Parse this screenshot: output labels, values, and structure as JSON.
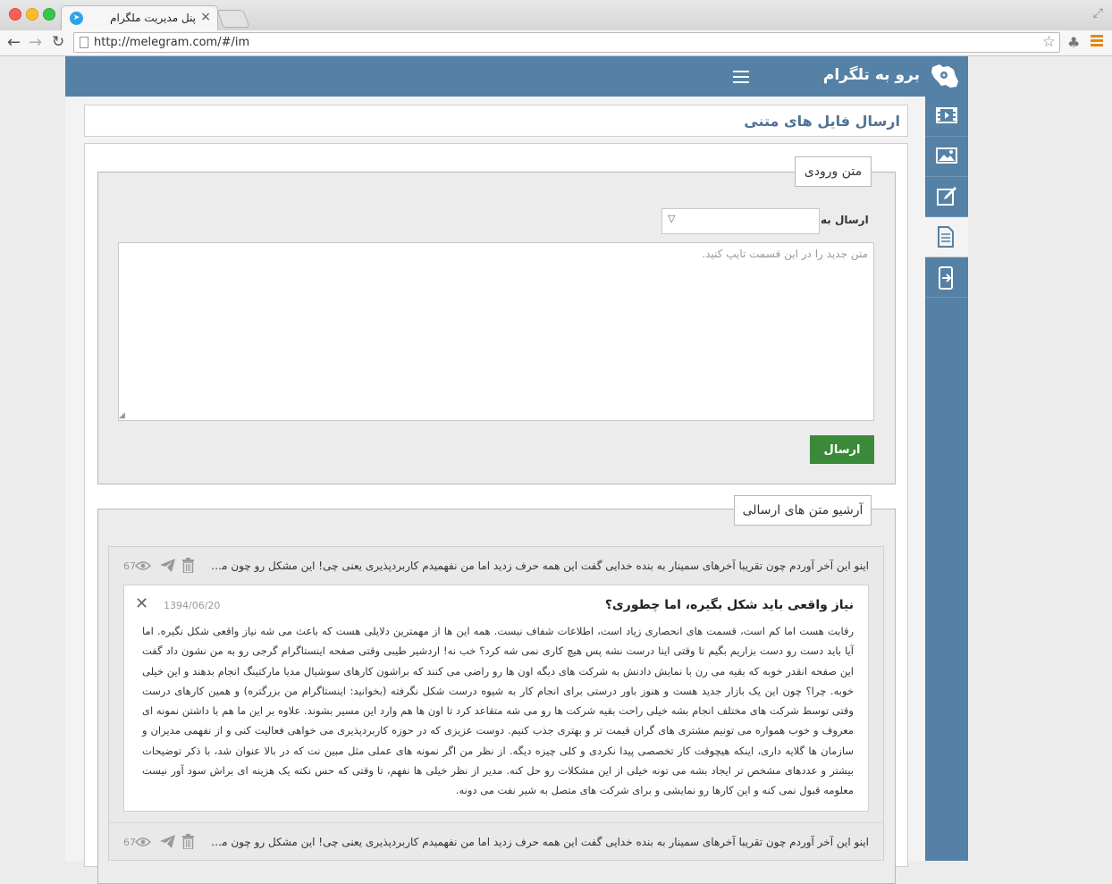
{
  "browser": {
    "tab_title": "پنل مدیریت ملگرام",
    "tab_close": "×",
    "url": "http://melegram.com/#/im"
  },
  "app": {
    "brand_title": "برو به تلگرام",
    "sidebar_icons": [
      "video-icon",
      "image-icon",
      "edit-icon",
      "document-icon",
      "mobile-export-icon"
    ],
    "active_sidebar": "document-icon",
    "accent_color": "#5581a6",
    "page_heading": "ارسال فایل های متنی"
  },
  "compose": {
    "legend": "متن ورودی",
    "send_to_label": "ارسال به",
    "send_to_value": "",
    "textarea_placeholder": "متن جدید را در این قسمت تایپ کنید.",
    "send_button": "ارسال",
    "send_button_color": "#3a8a3a"
  },
  "archive": {
    "legend": "آرشیو متن های ارسالی",
    "rows": [
      {
        "text": "اینو این آخر آوردم چون تقریبا آخرهای سمینار به بنده خدایی گفت این همه حرف زدید اما من نفهمیدم کاربردپذیری یعنی چی! این مشکل رو چون من...",
        "views": "67"
      },
      {
        "text": "اینو این آخر آوردم چون تقریبا آخرهای سمینار به بنده خدایی گفت این همه حرف زدید اما من نفهمیدم کاربردپذیری یعنی چی! این مشکل رو چون من...",
        "views": "67"
      }
    ],
    "expanded": {
      "title": "نیاز واقعی باید شکل بگیره، اما چطوری؟",
      "date": "1394/06/20",
      "close": "✕",
      "body": "رقابت هست اما کم است، قسمت های انحصاری زیاد است، اطلاعات شفاف نیست. همه این ها از مهمترین دلایلی هست که باعث می شه نیاز واقعی شکل نگیره. اما آیا باید دست رو دست بزاریم بگیم تا وقتی اینا درست نشه پس هیچ کاری نمی شه کرد؟ خب نه! اردشیر طیبی وقتی صفحه اینستاگرام گرجی رو به من نشون داد گفت این صفحه انقدر خوبه که بقیه می رن با نمایش دادنش به شرکت های دیگه اون ها رو راضی می کنند که براشون کارهای سوشیال مدیا مارکتینگ انجام بدهند و این خیلی خوبه. چرا؟ چون این یک بازار جدید هست و هنوز باور درستی برای انجام کار به شیوه درست شکل نگرفته (بخوانید: اینستاگرام من بزرگتره) و همین کارهای درست وقتی توسط شرکت های مختلف انجام بشه خیلی راحت بقیه شرکت ها رو می شه متقاعد کرد تا اون ها هم وارد این مسیر بشوند. علاوه بر این ما هم با داشتن نمونه ای معروف و خوب همواره می تونیم مشتری های گران قیمت تر و بهتری جذب کنیم. دوست عزیزی که در حوزه کاربردپذیری می خواهی فعالیت کنی و از نفهمی مدیران و سازمان ها گلایه داری، اینکه هیچوقت کار تخصصی پیدا نکردی و کلی چیزه دیگه. از نظر من اگر نمونه های عملی مثل مبین نت که در بالا عنوان شد، با ذکر توضیحات بیشتر و عددهای مشخص تر ایجاد بشه می تونه خیلی از این مشکلات رو حل کنه. مدیر از نظر خیلی ها نفهم، تا وقتی که حس نکته یک هزینه ای براش سود آور نیست معلومه قبول نمی کنه و این کارها رو نمایشی و برای شرکت های متصل به شیر نفت می دونه."
    }
  }
}
